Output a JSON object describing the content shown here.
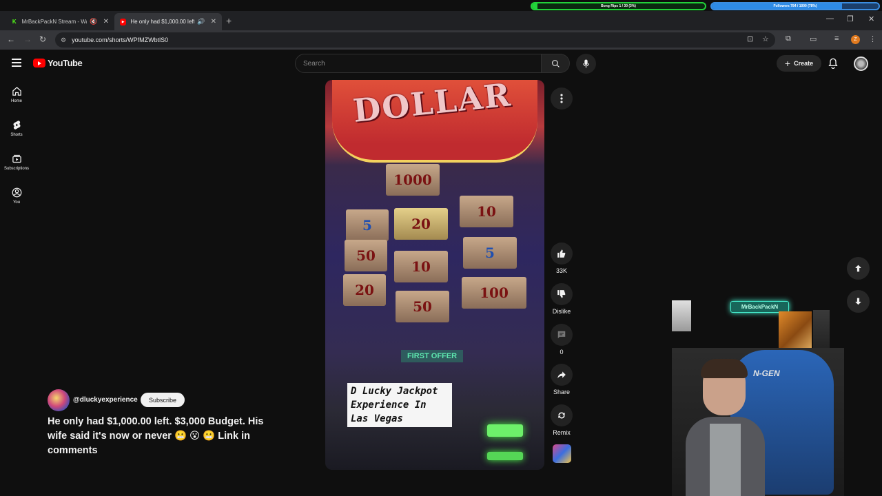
{
  "overlay": {
    "goal_label": "Bong Rips 1 / 30 (3%)",
    "goal_progress": 0.03,
    "followers_label": "Followers 784 / 1000 (78%)",
    "followers_progress": 0.78,
    "goal_color": "#22d33a",
    "followers_color": "#3b8de0",
    "stream_name": "MrBackPackN",
    "chair_brand": "N-GEN"
  },
  "browser": {
    "tabs": [
      {
        "title": "MrBackPackN Stream - Wat",
        "favicon": "K",
        "favicon_color": "#53fc18"
      },
      {
        "title": "He only had $1,000.00 left.",
        "favicon": "▶",
        "favicon_color": "#ff0000"
      }
    ],
    "url": "youtube.com/shorts/WPfMZWbtlS0",
    "profile_initial": "Z"
  },
  "masthead": {
    "logo_text": "YouTube",
    "search_placeholder": "Search",
    "create_label": "Create"
  },
  "guide": [
    {
      "label": "Home",
      "icon": "home-icon"
    },
    {
      "label": "Shorts",
      "icon": "shorts-icon"
    },
    {
      "label": "Subscriptions",
      "icon": "subscriptions-icon"
    },
    {
      "label": "You",
      "icon": "you-icon"
    }
  ],
  "video": {
    "caption": "D Lucky Jackpot Experience In Las Vegas",
    "sign_text": "DOLLAR",
    "bills": [
      "1000",
      "10",
      "5",
      "20",
      "50",
      "10",
      "5",
      "20",
      "100",
      "50"
    ],
    "panel_text": "FIRST OFFER"
  },
  "actions": {
    "like_count": "33K",
    "dislike_label": "Dislike",
    "comment_count": "0",
    "share_label": "Share",
    "remix_label": "Remix"
  },
  "short": {
    "channel": "@dluckyexperience",
    "subscribe_label": "Subscribe",
    "title": "He only had $1,000.00 left.  $3,000 Budget.  His wife said it's now or never 😬 😮 😬 Link in comments"
  }
}
